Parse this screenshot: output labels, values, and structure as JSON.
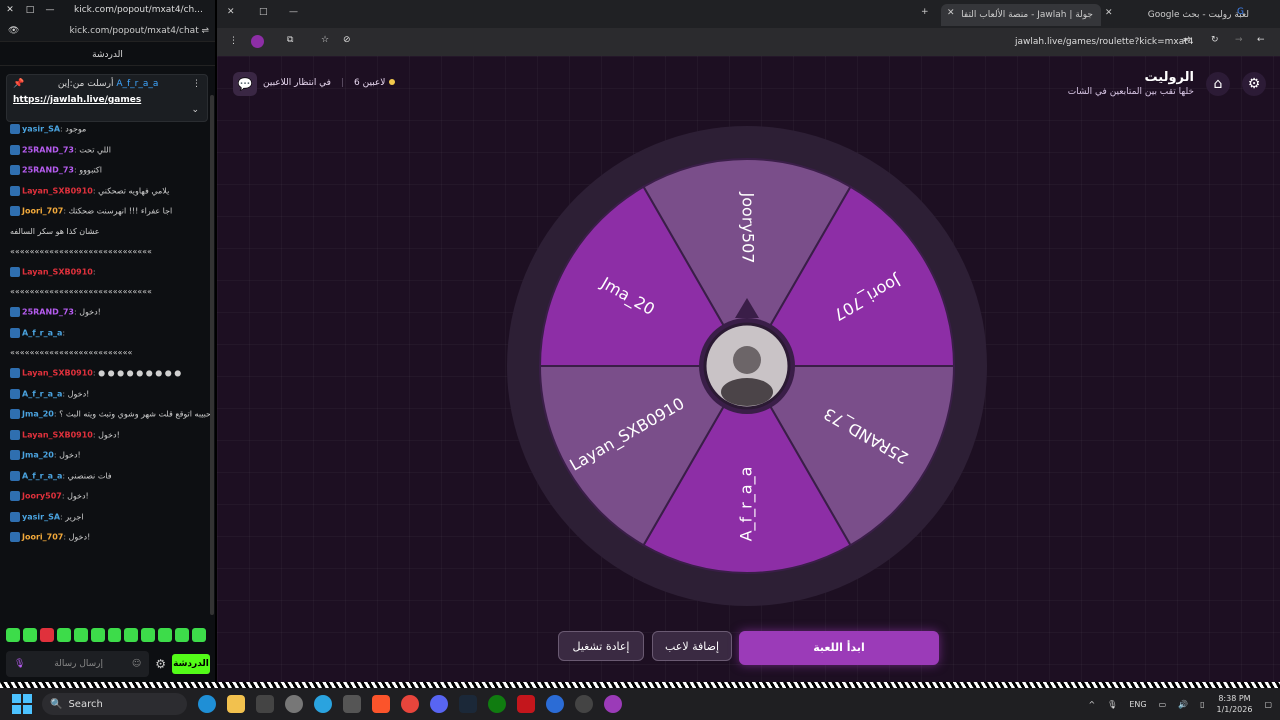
{
  "chat_window": {
    "title": "kick.com/popout/mxat4/ch...",
    "url": "kick.com/popout/mxat4/chat",
    "header": "الدردشة",
    "pinned": {
      "author": "A_f_r_a_a",
      "label": "أرسلت من:إين",
      "link": "https://jawlah.live/games"
    },
    "messages": [
      {
        "user": "yasir_SA",
        "color": "#4aa3df",
        "text": "موجود"
      },
      {
        "user": "25RAND_73",
        "color": "#b65cf0",
        "text": "اللي تحت"
      },
      {
        "user": "25RAND_73",
        "color": "#b65cf0",
        "text": "اكتبووو"
      },
      {
        "user": "Layan_SXB0910",
        "color": "#e0313c",
        "text": "يلامي فهاويه تصحكني"
      },
      {
        "user": "Joori_707",
        "color": "#f2a93b",
        "text": "اجا عفراء !!! انهرسنت ضحكتك"
      },
      {
        "user": "",
        "color": "#d0d0d0",
        "text": "عشان كذا هو سكر السالفه"
      },
      {
        "user": "",
        "color": "#d0d0d0",
        "text": "«««««««««««««««««««««««««««««"
      },
      {
        "user": "Layan_SXB0910",
        "color": "#e0313c",
        "text": ""
      },
      {
        "user": "",
        "color": "#d0d0d0",
        "text": "«««««««««««««««««««««««««««««"
      },
      {
        "user": "25RAND_73",
        "color": "#b65cf0",
        "text": "دخول!"
      },
      {
        "user": "A_f_r_a_a",
        "color": "#4aa3df",
        "text": ""
      },
      {
        "user": "",
        "color": "#d0d0d0",
        "text": "«««««««««««««««««««««««««"
      },
      {
        "user": "Layan_SXB0910",
        "color": "#e0313c",
        "text": "● ● ● ● ● ● ● ● ●"
      },
      {
        "user": "A_f_r_a_a",
        "color": "#4aa3df",
        "text": "دخول!"
      },
      {
        "user": "Jma_20",
        "color": "#4aa3df",
        "text": "حبيبه اتوقع قلت شهر وشوي وتبث ويته البث ؟"
      },
      {
        "user": "Layan_SXB0910",
        "color": "#e0313c",
        "text": "دخول!"
      },
      {
        "user": "Jma_20",
        "color": "#4aa3df",
        "text": "دخول!"
      },
      {
        "user": "A_f_r_a_a",
        "color": "#4aa3df",
        "text": "فات نصنصني"
      },
      {
        "user": "Joory507",
        "color": "#e0313c",
        "text": "دخول!"
      },
      {
        "user": "yasir_SA",
        "color": "#4aa3df",
        "text": "اجرير"
      },
      {
        "user": "Joori_707",
        "color": "#f2a93b",
        "text": "دخول!"
      }
    ],
    "input_placeholder": "إرسال رسالة",
    "send_label": "الدردشة"
  },
  "browser": {
    "tabs": [
      {
        "label": "لعبة روليت - بحث Google",
        "active": false
      },
      {
        "label": "جولة | Jawlah - منصة الألعاب التفا",
        "active": true
      }
    ],
    "url": "jawlah.live/games/roulette?kick=mxat4"
  },
  "page": {
    "title": "الروليت",
    "subtitle": "خلها تقب بين المتابعين في الشات",
    "players_count": "6 لاعبين",
    "waiting_text": "في انتظار اللاعبين",
    "wheel": {
      "segments": [
        {
          "name": "Joory507",
          "color": "#7a4e8a"
        },
        {
          "name": "Joori_707",
          "color": "#8d2ea6"
        },
        {
          "name": "25RAND_73",
          "color": "#7a4e8a"
        },
        {
          "name": "A_f_r_a_a",
          "color": "#8d2ea6"
        },
        {
          "name": "Layan_SXB0910",
          "color": "#7a4e8a"
        },
        {
          "name": "Jma_20",
          "color": "#8d2ea6"
        }
      ],
      "rim_color": "#2d1f35",
      "pointer_color": "#3a1e48"
    },
    "buttons": {
      "start": "ابدأ اللعبة",
      "add_player": "إضافة لاعب",
      "reset": "إعادة تشغيل"
    }
  },
  "taskbar": {
    "search": "Search",
    "lang": "ENG",
    "time": "8:38 PM",
    "date": "1/1/2026"
  }
}
